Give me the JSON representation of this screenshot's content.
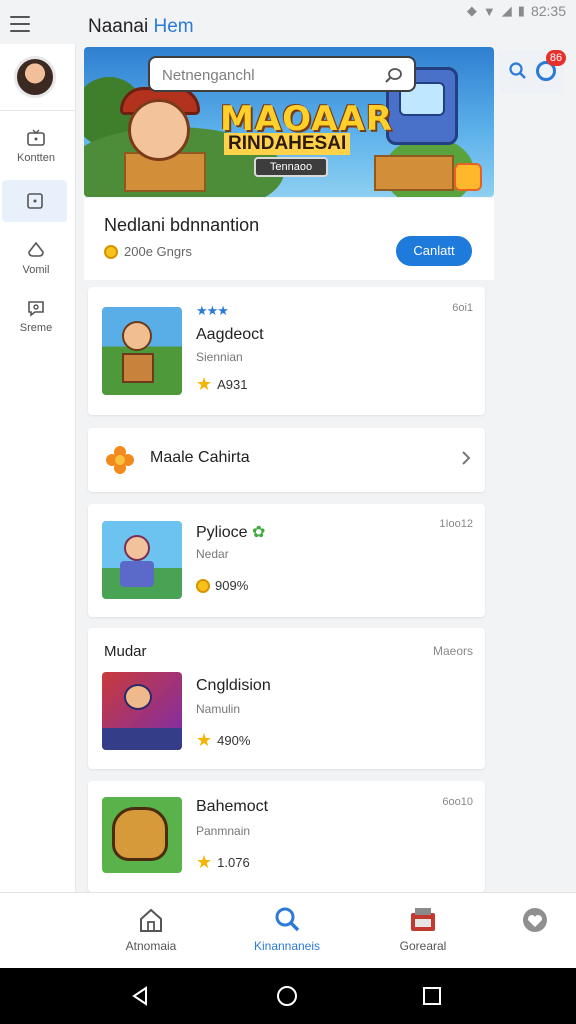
{
  "status_bar": {
    "time": "82:35"
  },
  "app": {
    "title_main": "Naanai",
    "title_accent": "Hem"
  },
  "rail": {
    "items": [
      {
        "label": "Kontten",
        "icon": "tv-icon"
      },
      {
        "label": "",
        "icon": "square-icon",
        "active": true
      },
      {
        "label": "Vomil",
        "icon": "spade-icon"
      },
      {
        "label": "Sreme",
        "icon": "chat-icon"
      }
    ]
  },
  "search": {
    "placeholder": "Netnenganchl"
  },
  "notifications": {
    "badge": "86"
  },
  "banner": {
    "title": "MAOAAR",
    "subtitle": "RINDAHESAI",
    "button": "Tennaoo"
  },
  "featured": {
    "title": "Nedlani bdnnantion",
    "meta": "200e Gngrs",
    "button": "Canlatt"
  },
  "cards": [
    {
      "name": "Aagdeoct",
      "sub": "Siennian",
      "rating": "A931",
      "corner": "6oi1"
    },
    {
      "name": "Pylioce",
      "sub": "Nedar",
      "rating": "909%",
      "corner": "1Ioo12"
    },
    {
      "name": "Cngldision",
      "sub": "Namulin",
      "rating": "490%",
      "corner": ""
    },
    {
      "name": "Bahemoct",
      "sub": "Panmnain",
      "rating": "1.076",
      "corner": "6oo10"
    }
  ],
  "row_link": {
    "label": "Maale Cahirta"
  },
  "section": {
    "title": "Mudar",
    "more": "Maeors"
  },
  "bottom_nav": {
    "items": [
      {
        "label": "Atnomaia",
        "icon": "home-icon"
      },
      {
        "label": "Kinannaneis",
        "icon": "search-icon",
        "active": true
      },
      {
        "label": "Gorearal",
        "icon": "shop-icon"
      },
      {
        "label": "",
        "icon": "heart-icon"
      }
    ]
  },
  "colors": {
    "accent": "#2a7ad8",
    "star": "#f5b400",
    "badge": "#e4312b"
  }
}
